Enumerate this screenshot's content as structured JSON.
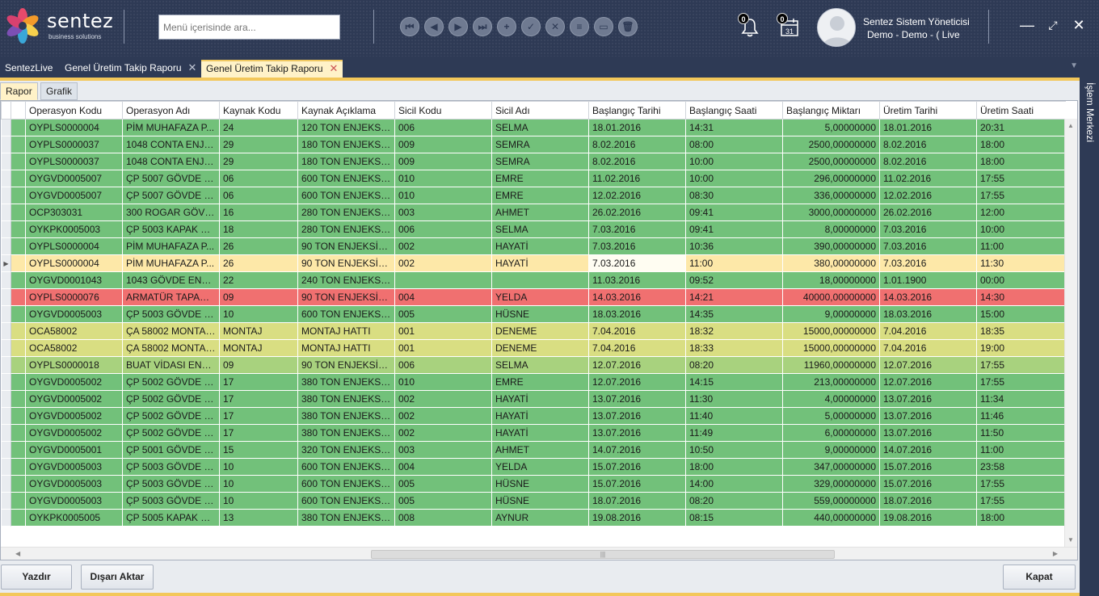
{
  "logo": {
    "name": "sentez",
    "subtitle": "business solutions"
  },
  "search": {
    "placeholder": "Menü içerisinde ara..."
  },
  "notifications": {
    "bell_count": "0",
    "calendar_count": "0",
    "calendar_day": "31"
  },
  "user": {
    "name": "Sentez Sistem Yöneticisi",
    "sub": "Demo - Demo - ( Live"
  },
  "tabs": [
    {
      "label": "SentezLive"
    },
    {
      "label": "Genel Üretim Takip Raporu"
    },
    {
      "label": "Genel Üretim Takip Raporu"
    }
  ],
  "subtabs": [
    {
      "label": "Rapor"
    },
    {
      "label": "Grafik"
    }
  ],
  "side_panel": {
    "label": "İşlem Merkezi"
  },
  "grid": {
    "columns": [
      "Operasyon Kodu",
      "Operasyon Adı",
      "Kaynak Kodu",
      "Kaynak Açıklama",
      "Sicil Kodu",
      "Sicil Adı",
      "Başlangıç Tarihi",
      "Başlangıç Saati",
      "Başlangıç Miktarı",
      "Üretim Tarihi",
      "Üretim Saati"
    ],
    "rows": [
      {
        "status": "g",
        "cells": [
          "OYPLS0000004",
          "PİM MUHAFAZA P...",
          "24",
          "120 TON ENJEKSİY...",
          "006",
          "SELMA",
          "18.01.2016",
          "14:31",
          "5,00000000",
          "18.01.2016",
          "20:31"
        ]
      },
      {
        "status": "g",
        "cells": [
          "OYPLS0000037",
          "1048 CONTA ENJE...",
          "29",
          "180 TON ENJEKSİY...",
          "009",
          "SEMRA",
          "8.02.2016",
          "08:00",
          "2500,00000000",
          "8.02.2016",
          "18:00"
        ]
      },
      {
        "status": "g",
        "cells": [
          "OYPLS0000037",
          "1048 CONTA ENJE...",
          "29",
          "180 TON ENJEKSİY...",
          "009",
          "SEMRA",
          "8.02.2016",
          "10:00",
          "2500,00000000",
          "8.02.2016",
          "18:00"
        ]
      },
      {
        "status": "g",
        "cells": [
          "OYGVD0005007",
          "ÇP 5007 GÖVDE E...",
          "06",
          "600 TON ENJEKSİY...",
          "010",
          "EMRE",
          "11.02.2016",
          "10:00",
          "296,00000000",
          "11.02.2016",
          "17:55"
        ]
      },
      {
        "status": "g",
        "cells": [
          "OYGVD0005007",
          "ÇP 5007 GÖVDE E...",
          "06",
          "600 TON ENJEKSİY...",
          "010",
          "EMRE",
          "12.02.2016",
          "08:30",
          "336,00000000",
          "12.02.2016",
          "17:55"
        ]
      },
      {
        "status": "g",
        "cells": [
          "OCP303031",
          "300 ROGAR GÖVD...",
          "16",
          "280 TON ENJEKSİY...",
          "003",
          "AHMET",
          "26.02.2016",
          "09:41",
          "3000,00000000",
          "26.02.2016",
          "12:00"
        ]
      },
      {
        "status": "g",
        "cells": [
          "OYKPK0005003",
          "ÇP 5003 KAPAK EN...",
          "18",
          "280 TON ENJEKSİY...",
          "006",
          "SELMA",
          "7.03.2016",
          "09:41",
          "8,00000000",
          "7.03.2016",
          "10:00"
        ]
      },
      {
        "status": "g",
        "cells": [
          "OYPLS0000004",
          "PİM MUHAFAZA P...",
          "26",
          "90 TON ENJEKSİYO...",
          "002",
          "HAYATİ",
          "7.03.2016",
          "10:36",
          "390,00000000",
          "7.03.2016",
          "11:00"
        ]
      },
      {
        "status": "y",
        "cells": [
          "OYPLS0000004",
          "PİM MUHAFAZA P...",
          "26",
          "90 TON ENJEKSİYO...",
          "002",
          "HAYATİ",
          "7.03.2016",
          "11:00",
          "380,00000000",
          "7.03.2016",
          "11:30"
        ]
      },
      {
        "status": "g",
        "cells": [
          "OYGVD0001043",
          "1043 GÖVDE ENJE...",
          "22",
          "240 TON ENJEKSİY...",
          "",
          "",
          "11.03.2016",
          "09:52",
          "18,00000000",
          "1.01.1900",
          "00:00"
        ]
      },
      {
        "status": "r",
        "cells": [
          "OYPLS0000076",
          "ARMATÜR TAPASI...",
          "09",
          "90 TON ENJEKSİYO...",
          "004",
          "YELDA",
          "14.03.2016",
          "14:21",
          "40000,00000000",
          "14.03.2016",
          "14:30"
        ]
      },
      {
        "status": "g",
        "cells": [
          "OYGVD0005003",
          "ÇP 5003 GÖVDE E...",
          "10",
          "600 TON ENJEKSİY...",
          "005",
          "HÜSNE",
          "18.03.2016",
          "14:35",
          "9,00000000",
          "18.03.2016",
          "15:00"
        ]
      },
      {
        "status": "k",
        "cells": [
          "OCA58002",
          "ÇA 58002 MONTAJ...",
          "MONTAJ",
          "MONTAJ HATTI",
          "001",
          "DENEME",
          "7.04.2016",
          "18:32",
          "15000,00000000",
          "7.04.2016",
          "18:35"
        ]
      },
      {
        "status": "k",
        "cells": [
          "OCA58002",
          "ÇA 58002 MONTAJ...",
          "MONTAJ",
          "MONTAJ HATTI",
          "001",
          "DENEME",
          "7.04.2016",
          "18:33",
          "15000,00000000",
          "7.04.2016",
          "19:00"
        ]
      },
      {
        "status": "o",
        "cells": [
          "OYPLS0000018",
          "BUAT VİDASI ENJE...",
          "09",
          "90 TON ENJEKSİYO...",
          "006",
          "SELMA",
          "12.07.2016",
          "08:20",
          "11960,00000000",
          "12.07.2016",
          "17:55"
        ]
      },
      {
        "status": "g",
        "cells": [
          "OYGVD0005002",
          "ÇP 5002 GÖVDE E...",
          "17",
          "380 TON ENJEKSİY...",
          "010",
          "EMRE",
          "12.07.2016",
          "14:15",
          "213,00000000",
          "12.07.2016",
          "17:55"
        ]
      },
      {
        "status": "g",
        "cells": [
          "OYGVD0005002",
          "ÇP 5002 GÖVDE E...",
          "17",
          "380 TON ENJEKSİY...",
          "002",
          "HAYATİ",
          "13.07.2016",
          "11:30",
          "4,00000000",
          "13.07.2016",
          "11:34"
        ]
      },
      {
        "status": "g",
        "cells": [
          "OYGVD0005002",
          "ÇP 5002 GÖVDE E...",
          "17",
          "380 TON ENJEKSİY...",
          "002",
          "HAYATİ",
          "13.07.2016",
          "11:40",
          "5,00000000",
          "13.07.2016",
          "11:46"
        ]
      },
      {
        "status": "g",
        "cells": [
          "OYGVD0005002",
          "ÇP 5002 GÖVDE E...",
          "17",
          "380 TON ENJEKSİY...",
          "002",
          "HAYATİ",
          "13.07.2016",
          "11:49",
          "6,00000000",
          "13.07.2016",
          "11:50"
        ]
      },
      {
        "status": "g",
        "cells": [
          "OYGVD0005001",
          "ÇP 5001 GÖVDE E...",
          "15",
          "320 TON ENJEKSİY...",
          "003",
          "AHMET",
          "14.07.2016",
          "10:50",
          "9,00000000",
          "14.07.2016",
          "11:00"
        ]
      },
      {
        "status": "g",
        "cells": [
          "OYGVD0005003",
          "ÇP 5003 GÖVDE E...",
          "10",
          "600 TON ENJEKSİY...",
          "004",
          "YELDA",
          "15.07.2016",
          "18:00",
          "347,00000000",
          "15.07.2016",
          "23:58"
        ]
      },
      {
        "status": "g",
        "cells": [
          "OYGVD0005003",
          "ÇP 5003 GÖVDE E...",
          "10",
          "600 TON ENJEKSİY...",
          "005",
          "HÜSNE",
          "15.07.2016",
          "14:00",
          "329,00000000",
          "15.07.2016",
          "17:55"
        ]
      },
      {
        "status": "g",
        "cells": [
          "OYGVD0005003",
          "ÇP 5003 GÖVDE E...",
          "10",
          "600 TON ENJEKSİY...",
          "005",
          "HÜSNE",
          "18.07.2016",
          "08:20",
          "559,00000000",
          "18.07.2016",
          "17:55"
        ]
      },
      {
        "status": "g",
        "cells": [
          "OYKPK0005005",
          "ÇP 5005 KAPAK EN...",
          "13",
          "380 TON ENJEKSİY...",
          "008",
          "AYNUR",
          "19.08.2016",
          "08:15",
          "440,00000000",
          "19.08.2016",
          "18:00"
        ]
      }
    ]
  },
  "buttons": {
    "print": "Yazdır",
    "export": "Dışarı Aktar",
    "close": "Kapat"
  },
  "colors": {
    "header_bg": "#2e3a55",
    "accent_strip": "#f3c75a",
    "row_green": "#72c17a",
    "row_light_green": "#a8d27e",
    "row_selected": "#fde8a8",
    "row_red": "#f07070",
    "row_khaki": "#d9de82"
  }
}
